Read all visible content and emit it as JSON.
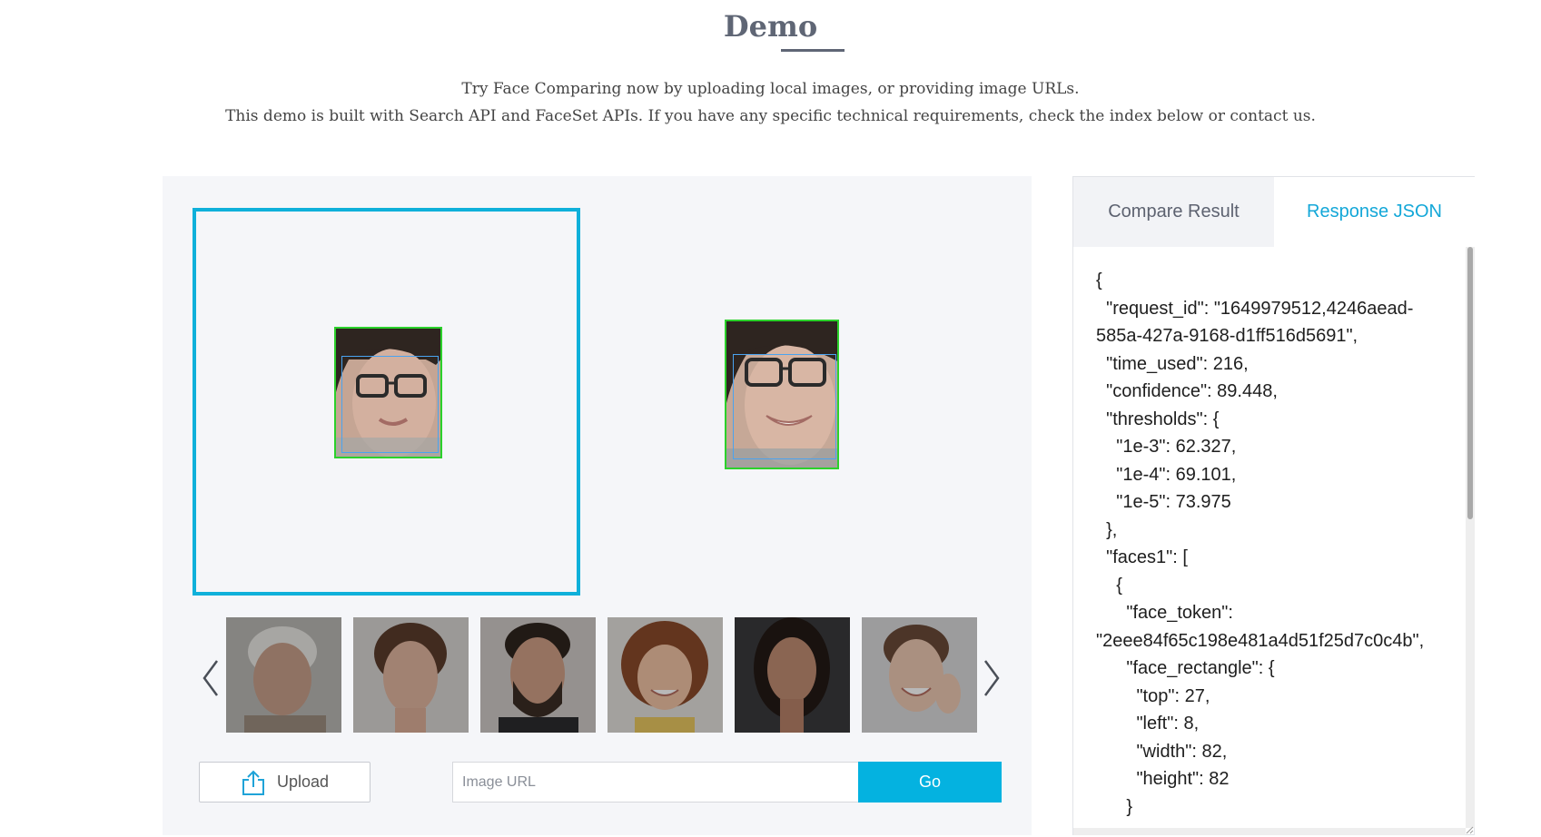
{
  "header": {
    "title": "Demo",
    "subtitle_line1": "Try Face Comparing now by uploading local images, or providing image URLs.",
    "subtitle_line2": "This demo is built with Search API and FaceSet APIs. If you have any specific technical requirements, check the index below or contact us."
  },
  "demo": {
    "images": [
      {
        "slot": "left",
        "selected": true,
        "face_detected": true
      },
      {
        "slot": "right",
        "selected": false,
        "face_detected": true
      }
    ],
    "thumbnails": [
      {
        "name": "thumbnail-elderly-man"
      },
      {
        "name": "thumbnail-young-woman"
      },
      {
        "name": "thumbnail-bearded-man"
      },
      {
        "name": "thumbnail-smiling-girl"
      },
      {
        "name": "thumbnail-dark-haired-woman"
      },
      {
        "name": "thumbnail-laughing-woman"
      }
    ],
    "upload_label": "Upload",
    "url_placeholder": "Image URL",
    "url_value": "",
    "go_label": "Go"
  },
  "results": {
    "tabs": [
      {
        "label": "Compare Result",
        "active": false
      },
      {
        "label": "Response JSON",
        "active": true
      }
    ],
    "json_lines": [
      "{",
      "  \"request_id\": \"1649979512,4246aead-",
      "585a-427a-9168-d1ff516d5691\",",
      "  \"time_used\": 216,",
      "  \"confidence\": 89.448,",
      "  \"thresholds\": {",
      "    \"1e-3\": 62.327,",
      "    \"1e-4\": 69.101,",
      "    \"1e-5\": 73.975",
      "  },",
      "  \"faces1\": [",
      "    {",
      "      \"face_token\":",
      "\"2eee84f65c198e481a4d51f25d7c0c4b\",",
      "      \"face_rectangle\": {",
      "        \"top\": 27,",
      "        \"left\": 8,",
      "        \"width\": 82,",
      "        \"height\": 82",
      "      }"
    ]
  },
  "colors": {
    "accent": "#0fb0da",
    "go_button": "#04b2e0",
    "face_box": "#2bd12b",
    "landmark_box": "#4aa3f0",
    "active_tab_text": "#13a7d8"
  }
}
